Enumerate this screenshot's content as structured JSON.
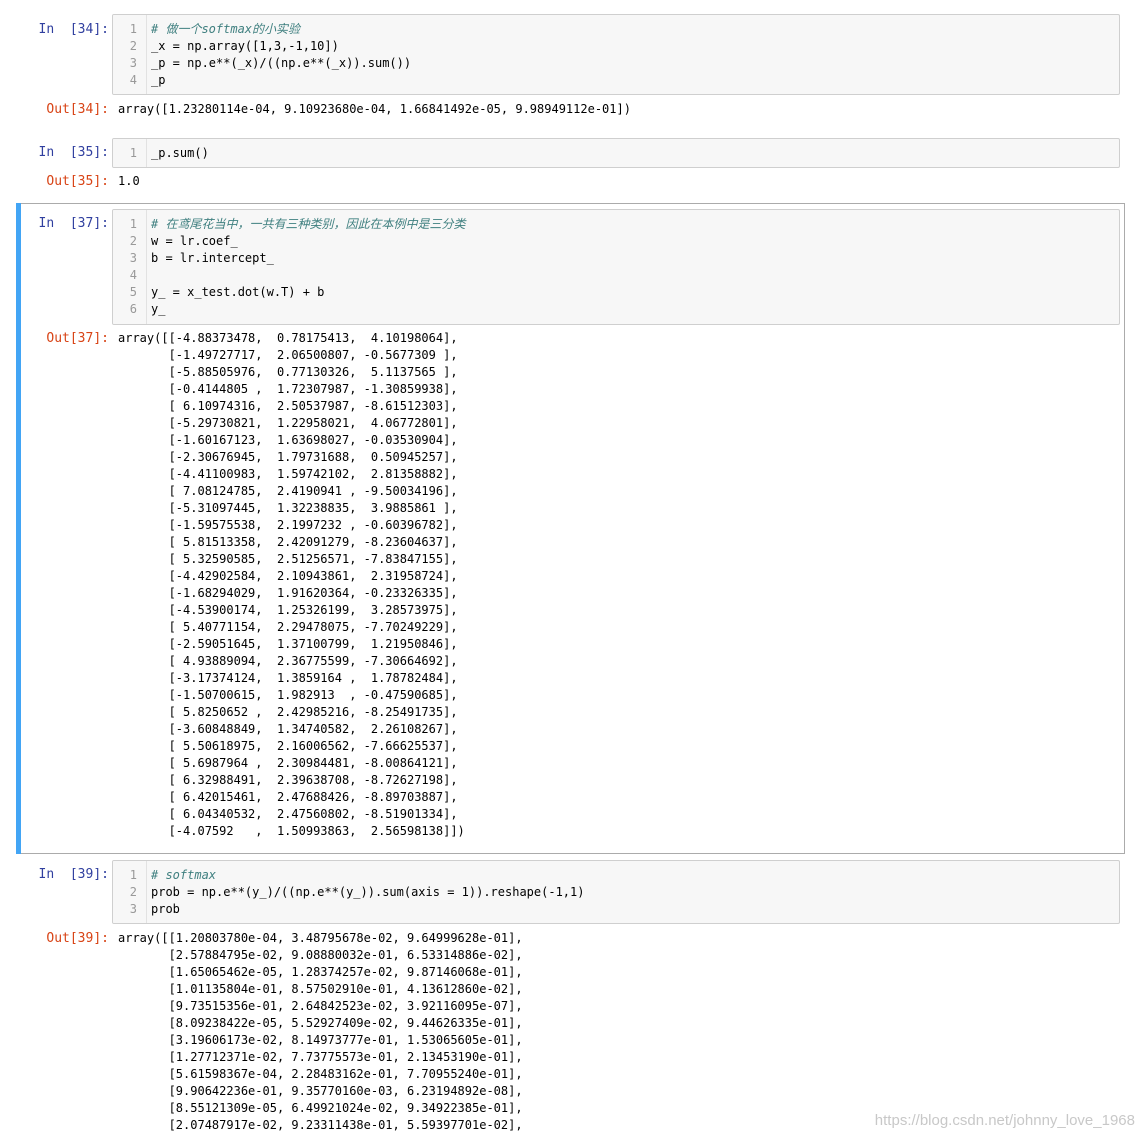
{
  "cells": [
    {
      "in_prompt": "In  [34]:",
      "code": [
        "# 做一个softmax的小实验",
        "_x = np.array([1,3,-1,10])",
        "_p = np.e**(_x)/((np.e**(_x)).sum())",
        "_p"
      ],
      "out_prompt": "Out[34]:",
      "output": "array([1.23280114e-04, 9.10923680e-04, 1.66841492e-05, 9.98949112e-01])"
    },
    {
      "in_prompt": "In  [35]:",
      "code": [
        "_p.sum()"
      ],
      "out_prompt": "Out[35]:",
      "output": "1.0"
    },
    {
      "in_prompt": "In  [37]:",
      "code": [
        "# 在鸢尾花当中，一共有三种类别，因此在本例中是三分类",
        "w = lr.coef_",
        "b = lr.intercept_",
        "",
        "y_ = x_test.dot(w.T) + b",
        "y_"
      ],
      "out_prompt": "Out[37]:",
      "output": "array([[-4.88373478,  0.78175413,  4.10198064],\n       [-1.49727717,  2.06500807, -0.5677309 ],\n       [-5.88505976,  0.77130326,  5.1137565 ],\n       [-0.4144805 ,  1.72307987, -1.30859938],\n       [ 6.10974316,  2.50537987, -8.61512303],\n       [-5.29730821,  1.22958021,  4.06772801],\n       [-1.60167123,  1.63698027, -0.03530904],\n       [-2.30676945,  1.79731688,  0.50945257],\n       [-4.41100983,  1.59742102,  2.81358882],\n       [ 7.08124785,  2.4190941 , -9.50034196],\n       [-5.31097445,  1.32238835,  3.9885861 ],\n       [-1.59575538,  2.1997232 , -0.60396782],\n       [ 5.81513358,  2.42091279, -8.23604637],\n       [ 5.32590585,  2.51256571, -7.83847155],\n       [-4.42902584,  2.10943861,  2.31958724],\n       [-1.68294029,  1.91620364, -0.23326335],\n       [-4.53900174,  1.25326199,  3.28573975],\n       [ 5.40771154,  2.29478075, -7.70249229],\n       [-2.59051645,  1.37100799,  1.21950846],\n       [ 4.93889094,  2.36775599, -7.30664692],\n       [-3.17374124,  1.3859164 ,  1.78782484],\n       [-1.50700615,  1.982913  , -0.47590685],\n       [ 5.8250652 ,  2.42985216, -8.25491735],\n       [-3.60848849,  1.34740582,  2.26108267],\n       [ 5.50618975,  2.16006562, -7.66625537],\n       [ 5.6987964 ,  2.30984481, -8.00864121],\n       [ 6.32988491,  2.39638708, -8.72627198],\n       [ 6.42015461,  2.47688426, -8.89703887],\n       [ 6.04340532,  2.47560802, -8.51901334],\n       [-4.07592   ,  1.50993863,  2.56598138]])"
    },
    {
      "in_prompt": "In  [39]:",
      "code": [
        "# softmax",
        "prob = np.e**(y_)/((np.e**(y_)).sum(axis = 1)).reshape(-1,1)",
        "prob"
      ],
      "out_prompt": "Out[39]:",
      "output": "array([[1.20803780e-04, 3.48795678e-02, 9.64999628e-01],\n       [2.57884795e-02, 9.08880032e-01, 6.53314886e-02],\n       [1.65065462e-05, 1.28374257e-02, 9.87146068e-01],\n       [1.01135804e-01, 8.57502910e-01, 4.13612860e-02],\n       [9.73515356e-01, 2.64842523e-02, 3.92116095e-07],\n       [8.09238422e-05, 5.52927409e-02, 9.44626335e-01],\n       [3.19606173e-02, 8.14973777e-01, 1.53065605e-01],\n       [1.27712371e-02, 7.73775573e-01, 2.13453190e-01],\n       [5.61598367e-04, 2.28483162e-01, 7.70955240e-01],\n       [9.90642236e-01, 9.35770160e-03, 6.23194892e-08],\n       [8.55121309e-05, 6.49921024e-02, 9.34922385e-01],\n       [2.07487917e-02, 9.23311438e-01, 5.59397701e-02],"
    }
  ],
  "watermark": "https://blog.csdn.net/johnny_love_1968"
}
